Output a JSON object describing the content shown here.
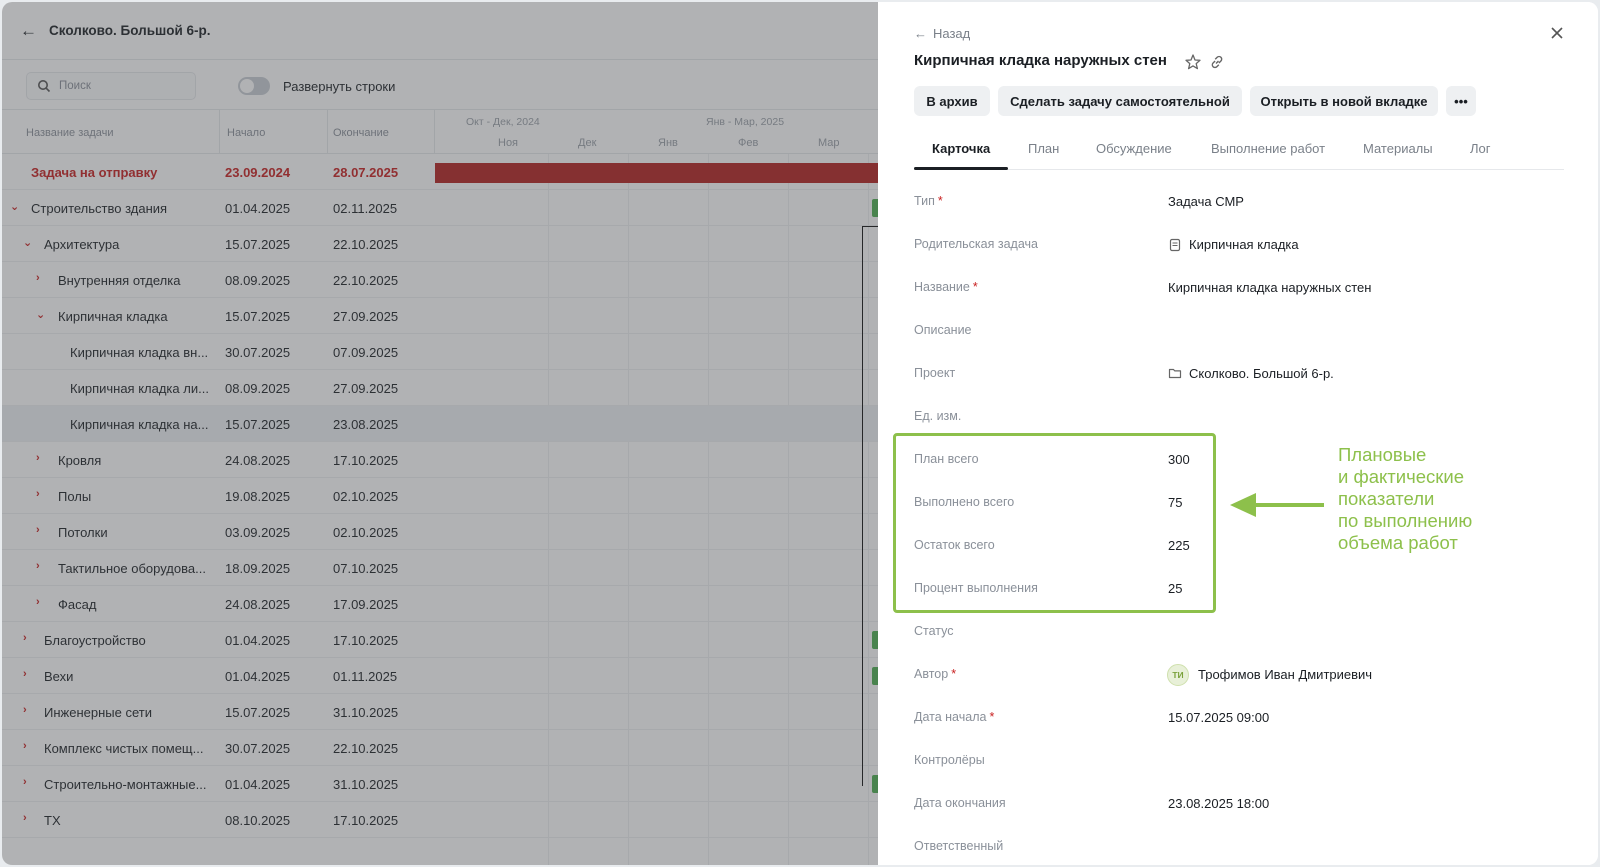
{
  "project": {
    "title": "Сколково. Большой 6-р."
  },
  "toolbar": {
    "search_placeholder": "Поиск",
    "toggle_label": "Развернуть строки"
  },
  "table": {
    "headers": {
      "name": "Название задачи",
      "start": "Начало",
      "end": "Окончание"
    },
    "timeline": {
      "periods": [
        "Окт - Дек, 2024",
        "Янв - Мар, 2025"
      ],
      "months": [
        "Ноя",
        "Дек",
        "Янв",
        "Фев",
        "Мар"
      ]
    },
    "rows": [
      {
        "name": "Задача на отправку",
        "start": "23.09.2024",
        "end": "28.07.2025"
      },
      {
        "name": "Строительство здания",
        "start": "01.04.2025",
        "end": "02.11.2025"
      },
      {
        "name": "Архитектура",
        "start": "15.07.2025",
        "end": "22.10.2025"
      },
      {
        "name": "Внутренняя отделка",
        "start": "08.09.2025",
        "end": "22.10.2025"
      },
      {
        "name": "Кирпичная кладка",
        "start": "15.07.2025",
        "end": "27.09.2025"
      },
      {
        "name": "Кирпичная кладка вн...",
        "start": "30.07.2025",
        "end": "07.09.2025"
      },
      {
        "name": "Кирпичная кладка ли...",
        "start": "08.09.2025",
        "end": "27.09.2025"
      },
      {
        "name": "Кирпичная кладка на...",
        "start": "15.07.2025",
        "end": "23.08.2025"
      },
      {
        "name": "Кровля",
        "start": "24.08.2025",
        "end": "17.10.2025"
      },
      {
        "name": "Полы",
        "start": "19.08.2025",
        "end": "02.10.2025"
      },
      {
        "name": "Потолки",
        "start": "03.09.2025",
        "end": "02.10.2025"
      },
      {
        "name": "Тактильное оборудова...",
        "start": "18.09.2025",
        "end": "07.10.2025"
      },
      {
        "name": "Фасад",
        "start": "24.08.2025",
        "end": "17.09.2025"
      },
      {
        "name": "Благоустройство",
        "start": "01.04.2025",
        "end": "17.10.2025"
      },
      {
        "name": "Вехи",
        "start": "01.04.2025",
        "end": "01.11.2025"
      },
      {
        "name": "Инженерные сети",
        "start": "15.07.2025",
        "end": "31.10.2025"
      },
      {
        "name": "Комплекс чистых помещ...",
        "start": "30.07.2025",
        "end": "22.10.2025"
      },
      {
        "name": "Строительно-монтажные...",
        "start": "01.04.2025",
        "end": "31.10.2025"
      },
      {
        "name": "ТХ",
        "start": "08.10.2025",
        "end": "17.10.2025"
      }
    ]
  },
  "panel": {
    "back_label": "Назад",
    "title": "Кирпичная кладка наружных стен",
    "buttons": {
      "archive": "В архив",
      "make_independent": "Сделать задачу самостоятельной",
      "open_new_tab": "Открыть в новой вкладке",
      "more": "•••"
    },
    "tabs": [
      "Карточка",
      "План",
      "Обсуждение",
      "Выполнение работ",
      "Материалы",
      "Лог"
    ],
    "fields": {
      "type": {
        "label": "Тип",
        "value": "Задача СМР"
      },
      "parent": {
        "label": "Родительская задача",
        "value": "Кирпичная кладка"
      },
      "name": {
        "label": "Название",
        "value": "Кирпичная кладка наружных стен"
      },
      "description": {
        "label": "Описание"
      },
      "project": {
        "label": "Проект",
        "value": "Сколково. Большой 6-р."
      },
      "unit": {
        "label": "Ед. изм."
      },
      "plan_total": {
        "label": "План всего",
        "value": "300"
      },
      "done_total": {
        "label": "Выполнено всего",
        "value": "75"
      },
      "remaining_total": {
        "label": "Остаток всего",
        "value": "225"
      },
      "percent_done": {
        "label": "Процент выполнения",
        "value": "25"
      },
      "status": {
        "label": "Статус"
      },
      "author": {
        "label": "Автор",
        "value": "Трофимов Иван Дмитриевич",
        "initials": "ТИ"
      },
      "start_date": {
        "label": "Дата начала",
        "value": "15.07.2025 09:00"
      },
      "controllers": {
        "label": "Контролёры"
      },
      "end_date": {
        "label": "Дата окончания",
        "value": "23.08.2025 18:00"
      },
      "responsible": {
        "label": "Ответственный"
      }
    },
    "required_mark": "*"
  },
  "annotation": {
    "lines": [
      "Плановые",
      "и фактические",
      "показатели",
      "по выполнению",
      "объема работ"
    ],
    "color": "#8dc04b"
  }
}
